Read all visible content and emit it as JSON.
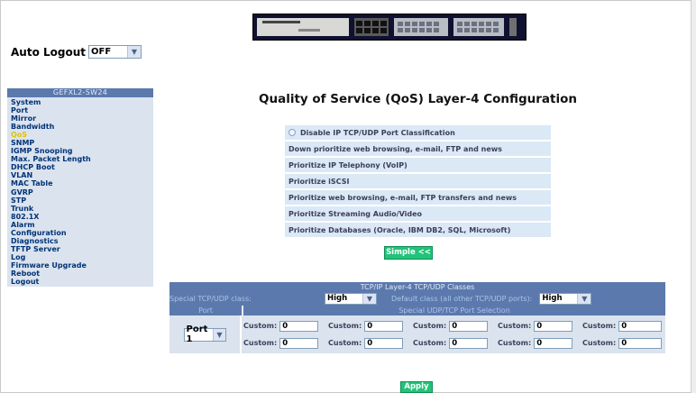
{
  "auto_logout": {
    "label": "Auto Logout",
    "value": "OFF"
  },
  "sidebar": {
    "title": "GEFXL2-SW24",
    "items": [
      "System",
      "Port",
      "Mirror",
      "Bandwidth",
      "QoS",
      "SNMP",
      "IGMP Snooping",
      "Max. Packet Length",
      "DHCP Boot",
      "VLAN",
      "MAC Table",
      "GVRP",
      "STP",
      "Trunk",
      "802.1X",
      "Alarm",
      "Configuration",
      "Diagnostics",
      "TFTP Server",
      "Log",
      "Firmware Upgrade",
      "Reboot",
      "Logout"
    ],
    "active_item": "QoS"
  },
  "main": {
    "title": "Quality of Service (QoS) Layer-4 Configuration",
    "options": [
      "Disable IP TCP/UDP Port Classification",
      "Down prioritize web browsing, e-mail, FTP and news",
      "Prioritize IP Telephony (VoIP)",
      "Prioritize iSCSI",
      "Prioritize web browsing, e-mail, FTP transfers and news",
      "Prioritize Streaming Audio/Video",
      "Prioritize Databases (Oracle, IBM DB2, SQL, Microsoft)"
    ],
    "selected_option_index": 0,
    "simple_button": "Simple <<",
    "apply_button": "Apply"
  },
  "tcp_table": {
    "title": "TCP/IP Layer-4 TCP/UDP Classes",
    "special_class_label": "Special TCP/UDP class:",
    "special_class_value": "High",
    "default_class_label": "Default class (all other TCP/UDP ports):",
    "default_class_value": "High",
    "port_header": "Port",
    "selection_header": "Special UDP/TCP Port Selection",
    "port_value": "Port 1",
    "custom_label": "Custom:",
    "custom_values": [
      [
        "0",
        "0",
        "0",
        "0",
        "0"
      ],
      [
        "0",
        "0",
        "0",
        "0",
        "0"
      ]
    ]
  },
  "colors": {
    "header_bg": "#5b79ad",
    "menu_bg": "#dbe3ee",
    "menu_text": "#003377",
    "active_menu_text": "#e0c300",
    "button_green": "#22c37a"
  }
}
